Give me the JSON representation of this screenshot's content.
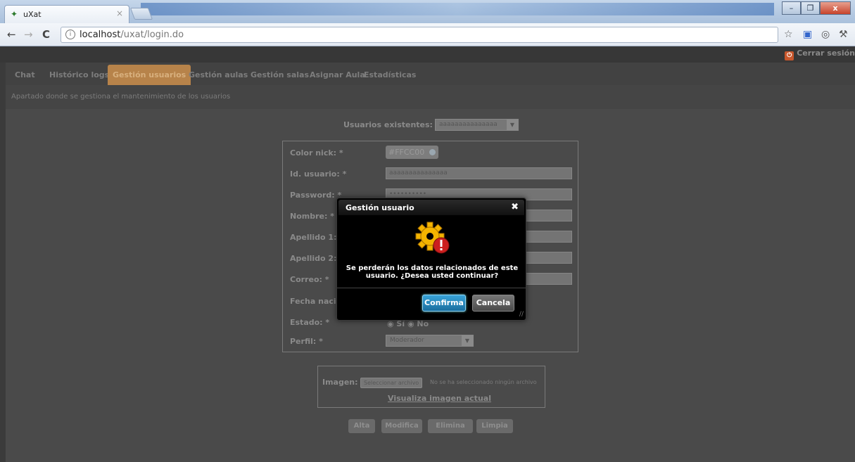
{
  "browser": {
    "tab_title": "uXat",
    "tab_close": "×",
    "url_host": "localhost",
    "url_path": "/uxat/login.do",
    "window_buttons": [
      "–",
      "❐",
      "x"
    ]
  },
  "header": {
    "logout_label": "Cerrar sesión"
  },
  "nav": {
    "tabs": [
      {
        "label": "Chat"
      },
      {
        "label": "Histórico logs"
      },
      {
        "label": "Gestión usuarios"
      },
      {
        "label": "Gestión aulas"
      },
      {
        "label": "Gestión salas"
      },
      {
        "label": "Asignar Aula"
      },
      {
        "label": "Estadísticas"
      }
    ],
    "active_tab": "Gestión usuarios"
  },
  "subtitle": "Apartado donde se gestiona el mantenimiento de los usuarios",
  "existing_users": {
    "label": "Usuarios existentes:",
    "selected": "aaaaaaaaaaaaaaa"
  },
  "form": {
    "color_label": "Color nick: *",
    "color_value": "#FFCC00",
    "id_label": "Id. usuario: *",
    "id_value": "aaaaaaaaaaaaaaa",
    "password_label": "Password: *",
    "password_value": "••••••••••",
    "nombre_label": "Nombre: *",
    "apellido1_label": "Apellido 1: *",
    "apellido2_label": "Apellido 2: *",
    "correo_label": "Correo: *",
    "fecha_label": "Fecha nacim",
    "estado_label": "Estado: *",
    "estado_options": "◉ Sí   ◉ No",
    "perfil_label": "Perfil: *",
    "perfil_value": "Moderador"
  },
  "image": {
    "label": "Imagen:",
    "file_button": "Seleccionar archivo",
    "file_status": "No se ha seleccionado ningún archivo",
    "view_link": "Visualiza imagen actual"
  },
  "actions": {
    "alta": "Alta",
    "modifica": "Modifica",
    "elimina": "Elimina",
    "limpia": "Limpia"
  },
  "modal": {
    "title": "Gestión usuario",
    "close": "✖",
    "message": "Se perderán los datos relacionados de este usuario. ¿Desea usted continuar?",
    "confirm": "Confirma",
    "cancel": "Cancela"
  },
  "colors": {
    "active_tab": "#b7834a",
    "confirm_button": "#1a6e9e",
    "gear": "#f4b400",
    "warning": "#cc1f1f"
  }
}
